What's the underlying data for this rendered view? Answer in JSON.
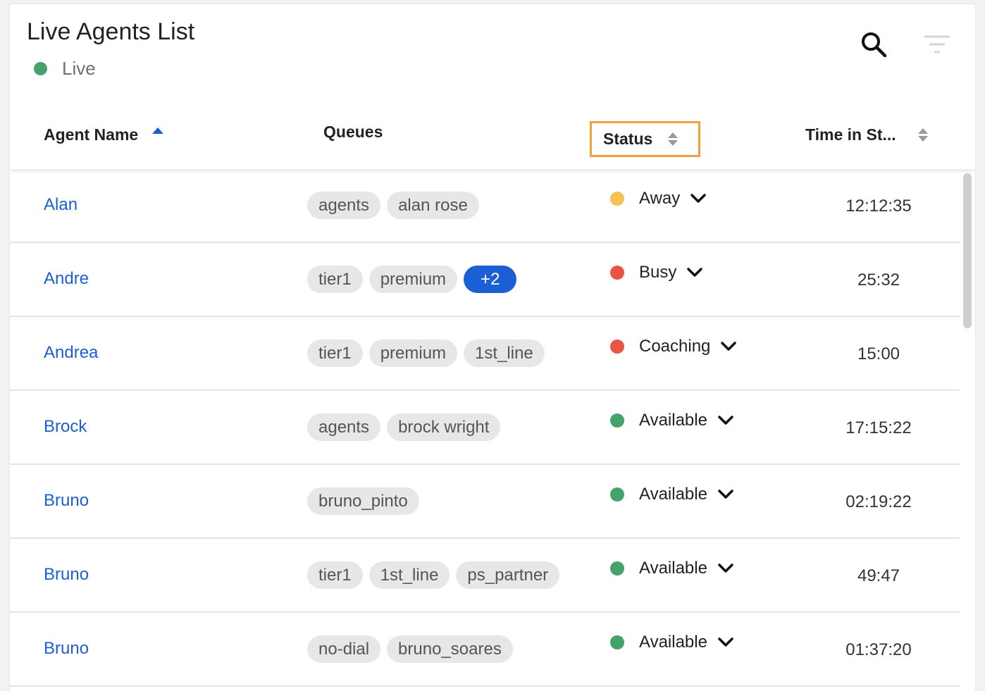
{
  "title": "Live Agents List",
  "live_label": "Live",
  "columns": {
    "agent": "Agent Name",
    "queues": "Queues",
    "status": "Status",
    "time": "Time in St..."
  },
  "colors": {
    "accent": "#1a5fd4",
    "live": "#43a36b",
    "away": "#f7c153",
    "busy": "#ea5445",
    "available": "#43a36b",
    "highlight": "#f0a13a"
  },
  "rows": [
    {
      "name": "Alan",
      "queues": [
        "agents",
        "alan rose"
      ],
      "more": "",
      "status": "Away",
      "status_color": "#f7c153",
      "time": "12:12:35"
    },
    {
      "name": "Andre",
      "queues": [
        "tier1",
        "premium"
      ],
      "more": "+2",
      "status": "Busy",
      "status_color": "#ea5445",
      "time": "25:32"
    },
    {
      "name": "Andrea",
      "queues": [
        "tier1",
        "premium",
        "1st_line"
      ],
      "more": "",
      "status": "Coaching",
      "status_color": "#ea5445",
      "time": "15:00"
    },
    {
      "name": "Brock",
      "queues": [
        "agents",
        "brock wright"
      ],
      "more": "",
      "status": "Available",
      "status_color": "#43a36b",
      "time": "17:15:22"
    },
    {
      "name": "Bruno",
      "queues": [
        "bruno_pinto"
      ],
      "more": "",
      "status": "Available",
      "status_color": "#43a36b",
      "time": "02:19:22"
    },
    {
      "name": "Bruno",
      "queues": [
        "tier1",
        "1st_line",
        "ps_partner"
      ],
      "more": "",
      "status": "Available",
      "status_color": "#43a36b",
      "time": "49:47"
    },
    {
      "name": "Bruno",
      "queues": [
        "no-dial",
        "bruno_soares"
      ],
      "more": "",
      "status": "Available",
      "status_color": "#43a36b",
      "time": "01:37:20"
    }
  ]
}
